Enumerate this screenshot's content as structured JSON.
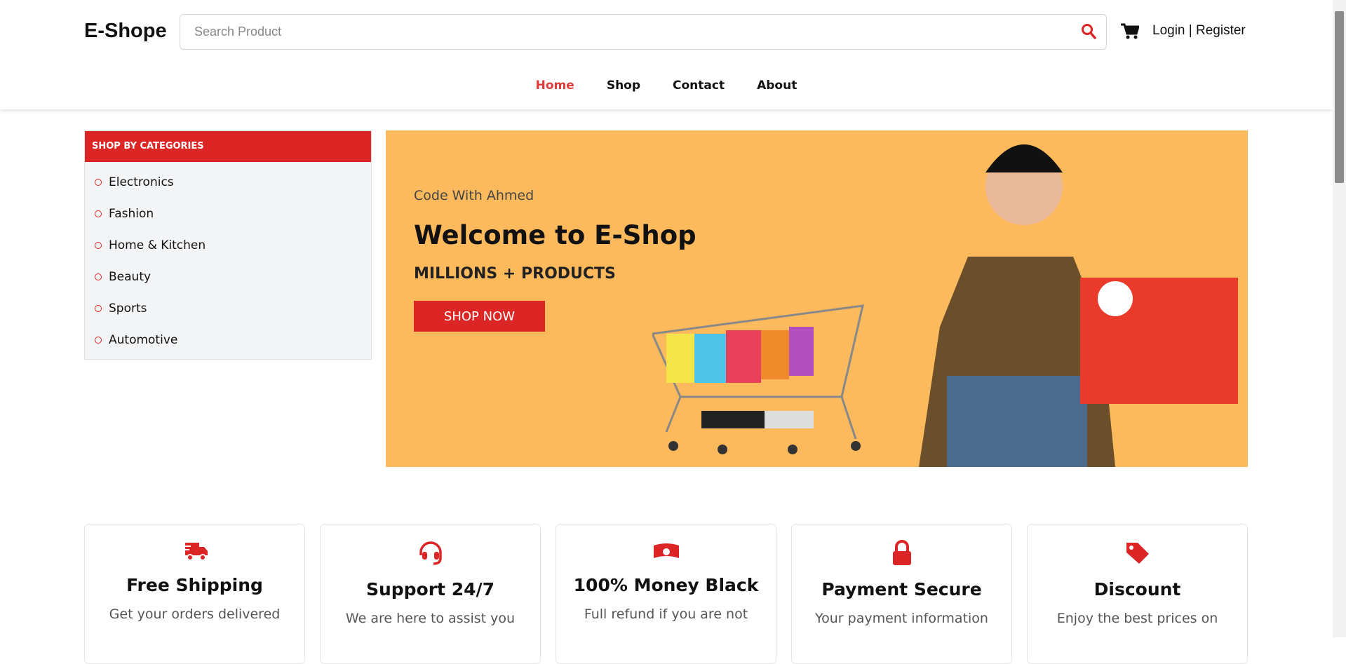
{
  "header": {
    "logo": "E-Shope",
    "search_placeholder": "Search Product",
    "login": "Login",
    "separator": " | ",
    "register": "Register"
  },
  "nav": [
    {
      "label": "Home",
      "active": true
    },
    {
      "label": "Shop"
    },
    {
      "label": "Contact"
    },
    {
      "label": "About"
    }
  ],
  "sidebar": {
    "title": "SHOP BY CATEGORIES",
    "items": [
      "Electronics",
      "Fashion",
      "Home & Kitchen",
      "Beauty",
      "Sports",
      "Automotive"
    ]
  },
  "banner": {
    "subtitle": "Code With Ahmed",
    "title": "Welcome to E-Shop",
    "tagline": "MILLIONS + PRODUCTS",
    "button": "SHOP NOW"
  },
  "features": [
    {
      "icon": "truck-icon",
      "title": "Free Shipping",
      "text": "Get your orders delivered"
    },
    {
      "icon": "headset-icon",
      "title": "Support 24/7",
      "text": "We are here to assist you"
    },
    {
      "icon": "money-icon",
      "title": "100% Money Black",
      "text": "Full refund if you are not"
    },
    {
      "icon": "lock-icon",
      "title": "Payment Secure",
      "text": "Your payment information"
    },
    {
      "icon": "tag-icon",
      "title": "Discount",
      "text": "Enjoy the best prices on"
    }
  ],
  "colors": {
    "accent": "#dc2626",
    "banner_bg": "#fdba5c"
  }
}
